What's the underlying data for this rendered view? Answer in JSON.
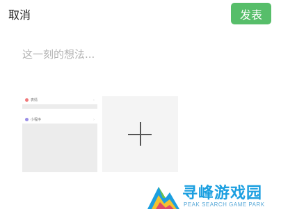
{
  "header": {
    "cancel_label": "取消",
    "publish_label": "发表"
  },
  "compose": {
    "placeholder": "这一刻的想法..."
  },
  "thumbnail": {
    "rows": [
      {
        "label": "表情",
        "icon_color": "#f0787a"
      },
      {
        "label": "小程序",
        "icon_color": "#9a8ee6"
      }
    ]
  },
  "add_photo": {
    "icon": "plus-icon"
  },
  "watermark": {
    "title": "寻峰游戏园",
    "subtitle": "PEAK SEARCH GAME PARK"
  },
  "colors": {
    "accent": "#57be6a",
    "watermark_blue": "#1b9fe0"
  }
}
